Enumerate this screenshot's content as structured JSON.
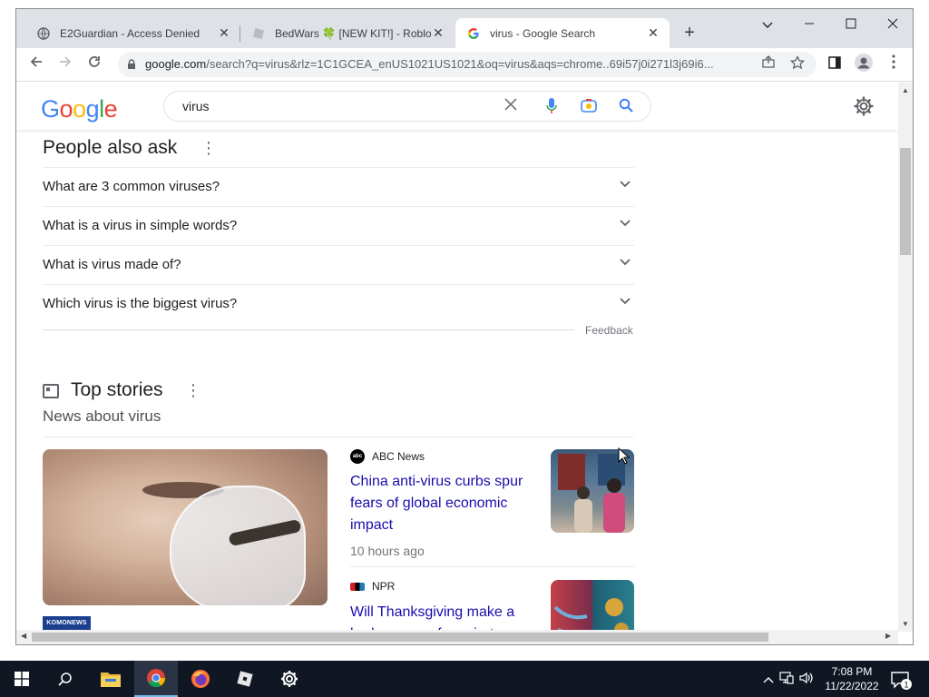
{
  "browser": {
    "tabs": [
      {
        "title": "E2Guardian - Access Denied",
        "icon": "globe-icon",
        "active": false
      },
      {
        "title": "BedWars 🍀 [NEW KIT!] - Roblox",
        "icon": "roblox-icon",
        "active": false
      },
      {
        "title": "virus - Google Search",
        "icon": "google-icon",
        "active": true
      }
    ],
    "close_glyph": "✕",
    "new_tab_glyph": "+",
    "url_host": "google.com",
    "url_rest": "/search?q=virus&rlz=1C1GCEA_enUS1021US1021&oq=virus&aqs=chrome..69i57j0i271l3j69i6..."
  },
  "search": {
    "logo": "Google",
    "query": "virus"
  },
  "people_also_ask": {
    "title": "People also ask",
    "questions": [
      "What are 3 common viruses?",
      "What is a virus in simple words?",
      "What is virus made of?",
      "Which virus is the biggest virus?"
    ],
    "feedback": "Feedback"
  },
  "top_stories": {
    "title": "Top stories",
    "subtitle": "News about virus",
    "main_source_logo": "KOMONEWS",
    "stories": [
      {
        "source": "ABC News",
        "source_logo": "abc",
        "headline": "China anti-virus curbs spur fears of global economic impact",
        "time": "10 hours ago"
      },
      {
        "source": "NPR",
        "source_logo": "NPR",
        "headline": "Will Thanksgiving make a bad season of respiratory",
        "time": ""
      }
    ]
  },
  "taskbar": {
    "apps": [
      "start-icon",
      "search-icon",
      "file-explorer-icon",
      "chrome-icon",
      "firefox-icon",
      "roblox-icon",
      "settings-icon"
    ],
    "time": "7:08 PM",
    "date": "11/22/2022",
    "notification_count": "1"
  },
  "colors": {
    "link": "#1a0dab",
    "taskbar": "#101622",
    "tabstrip": "#dee1e6"
  }
}
